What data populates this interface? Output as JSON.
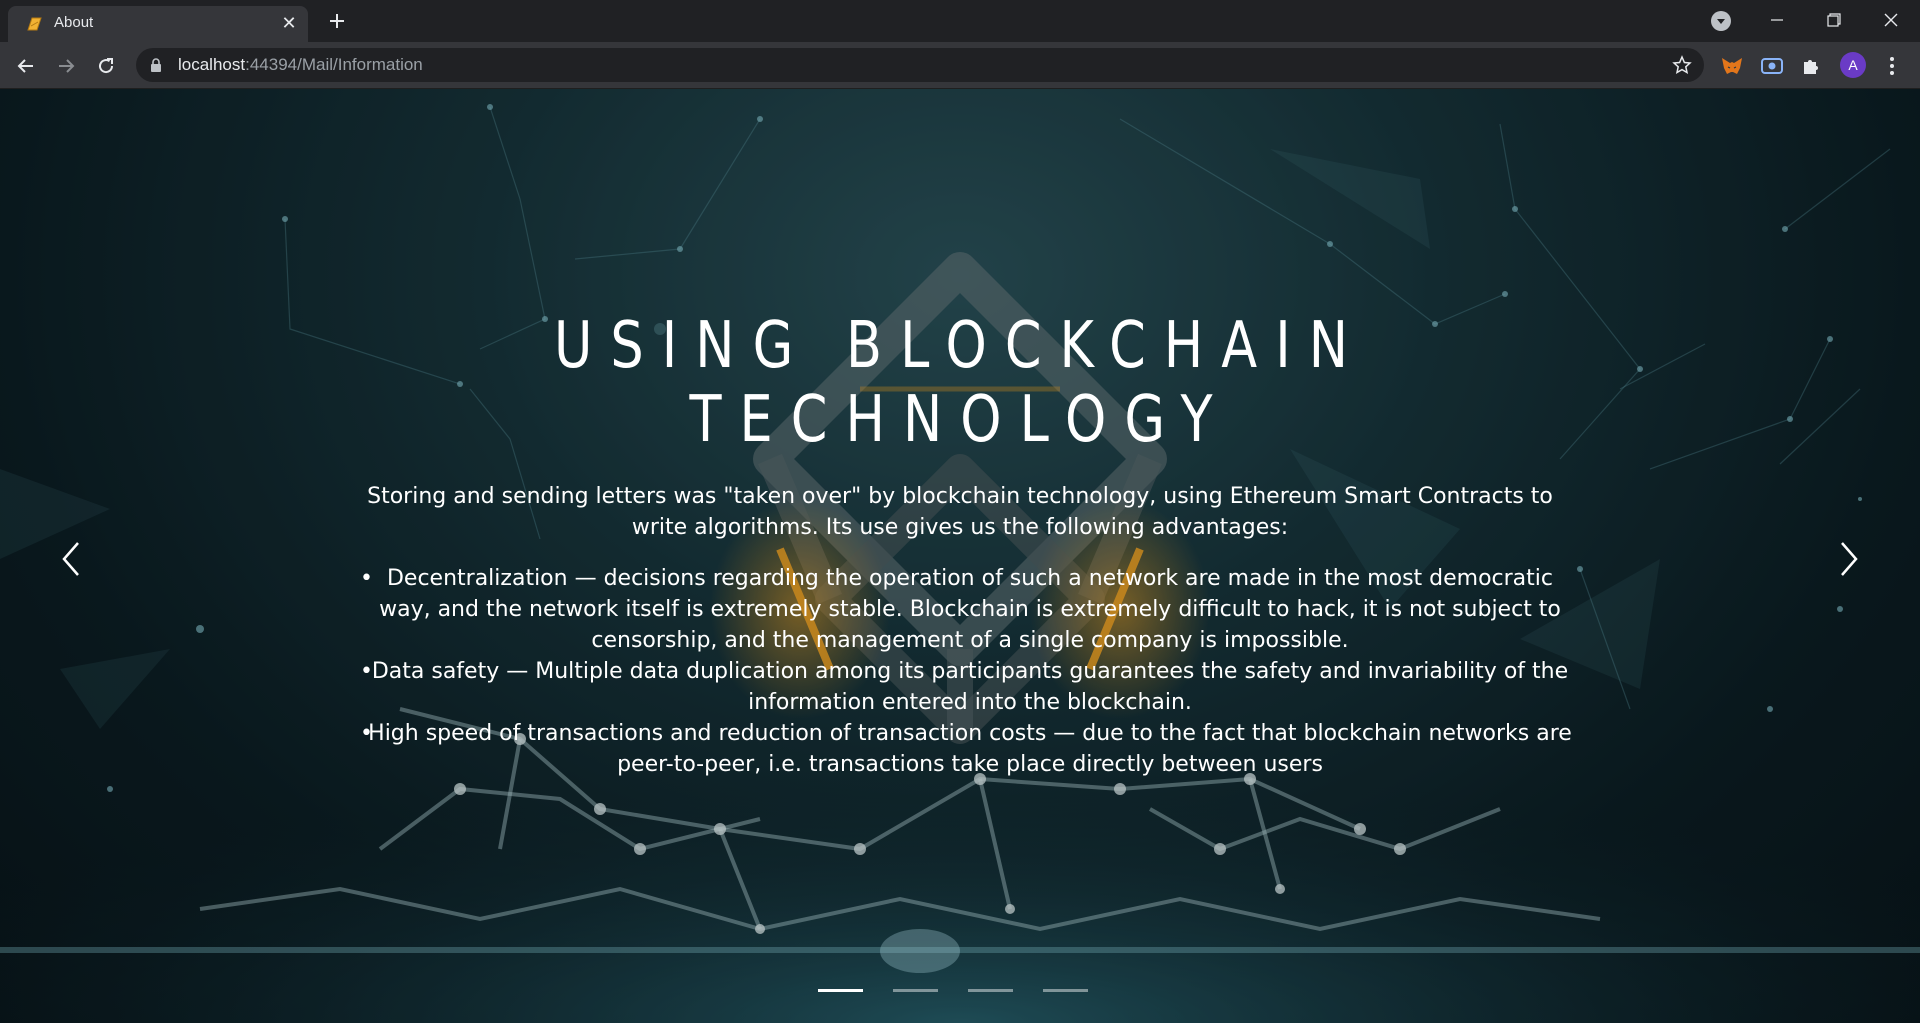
{
  "browser": {
    "tab_title": "About",
    "url_host": "localhost",
    "url_path": ":44394/Mail/Information",
    "avatar_letter": "A"
  },
  "slide": {
    "title_line1": "USING BLOCKCHAIN",
    "title_line2": "TECHNOLOGY",
    "intro": "Storing and sending letters was \"taken over\" by blockchain technology, using Ethereum Smart Contracts to write algorithms. Its use gives us the following advantages:",
    "advantages": [
      "Decentralization — decisions regarding the operation of such a network are made in the most democratic way, and the network itself is extremely stable. Blockchain is extremely difficult to hack, it is not subject to censorship, and the management of a single company is impossible.",
      " Data safety — Multiple data duplication among its participants guarantees the safety and invariability of the information entered into the blockchain.",
      "High speed of transactions and reduction of transaction costs — due to the fact that blockchain networks are peer-to-peer, i.e. transactions take place directly between users"
    ]
  },
  "carousel": {
    "slide_count": 4,
    "active_index": 0
  },
  "colors": {
    "background_dark": "#0c1e24",
    "background_teal": "#2a5159",
    "glow_orange": "#f5a623",
    "text": "#ffffff"
  },
  "icons": [
    "metamask-icon",
    "screen-capture-icon",
    "extensions-puzzle-icon",
    "star-icon",
    "lock-icon"
  ]
}
